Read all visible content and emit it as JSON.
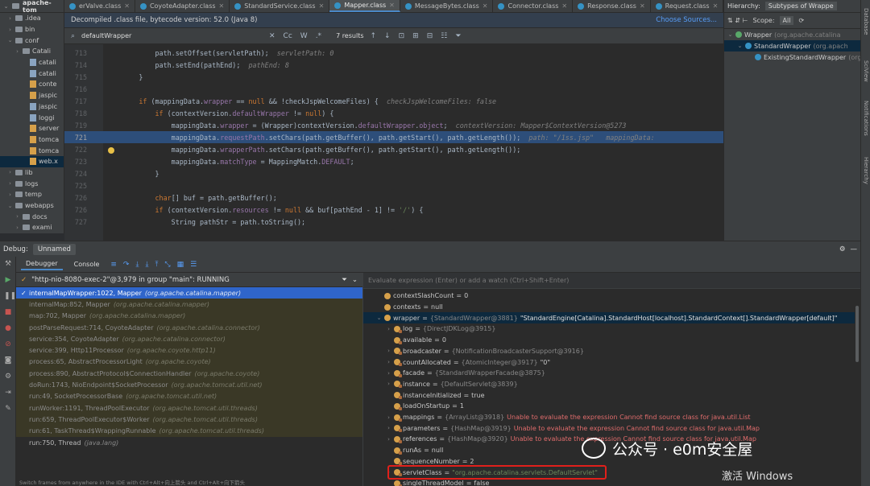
{
  "project": {
    "root": "apache-tom",
    "items": [
      {
        "label": ".idea",
        "kind": "folder",
        "indent": 1,
        "caret": "›"
      },
      {
        "label": "bin",
        "kind": "folder",
        "indent": 1,
        "caret": "›"
      },
      {
        "label": "conf",
        "kind": "folder",
        "indent": 1,
        "caret": "⌄"
      },
      {
        "label": "Catali",
        "kind": "folder",
        "indent": 2,
        "caret": "›"
      },
      {
        "label": "catali",
        "kind": "file",
        "indent": 3,
        "caret": ""
      },
      {
        "label": "catali",
        "kind": "file",
        "indent": 3,
        "caret": ""
      },
      {
        "label": "conte",
        "kind": "xml",
        "indent": 3,
        "caret": ""
      },
      {
        "label": "jaspic",
        "kind": "xml",
        "indent": 3,
        "caret": ""
      },
      {
        "label": "jaspic",
        "kind": "file",
        "indent": 3,
        "caret": ""
      },
      {
        "label": "loggi",
        "kind": "file",
        "indent": 3,
        "caret": ""
      },
      {
        "label": "server",
        "kind": "xml",
        "indent": 3,
        "caret": ""
      },
      {
        "label": "tomca",
        "kind": "xml",
        "indent": 3,
        "caret": ""
      },
      {
        "label": "tomca",
        "kind": "xml",
        "indent": 3,
        "caret": ""
      },
      {
        "label": "web.x",
        "kind": "xml",
        "indent": 3,
        "caret": "",
        "selected": true
      },
      {
        "label": "lib",
        "kind": "folder",
        "indent": 1,
        "caret": "›"
      },
      {
        "label": "logs",
        "kind": "folder",
        "indent": 1,
        "caret": "›"
      },
      {
        "label": "temp",
        "kind": "folder",
        "indent": 1,
        "caret": "›"
      },
      {
        "label": "webapps",
        "kind": "folder",
        "indent": 1,
        "caret": "⌄"
      },
      {
        "label": "docs",
        "kind": "folder",
        "indent": 2,
        "caret": "›"
      },
      {
        "label": "exami",
        "kind": "folder",
        "indent": 2,
        "caret": "›"
      }
    ]
  },
  "tabs": [
    {
      "label": "erValve.class",
      "active": false
    },
    {
      "label": "CoyoteAdapter.class",
      "active": false
    },
    {
      "label": "StandardService.class",
      "active": false
    },
    {
      "label": "Mapper.class",
      "active": true
    },
    {
      "label": "MessageBytes.class",
      "active": false
    },
    {
      "label": "Connector.class",
      "active": false
    },
    {
      "label": "Response.class",
      "active": false
    },
    {
      "label": "Request.class",
      "active": false
    }
  ],
  "banner": {
    "text": "Decompiled .class file, bytecode version: 52.0 (Java 8)",
    "link": "Choose Sources..."
  },
  "search": {
    "query": "defaultWrapper",
    "results": "7 results",
    "case_label": "Cc",
    "word_label": "W"
  },
  "code": [
    {
      "n": "713",
      "t": [
        [
          "",
          "            path.setOffset(servletPath);  "
        ],
        [
          "cm",
          "servletPath: 0"
        ]
      ]
    },
    {
      "n": "714",
      "t": [
        [
          "",
          "            path.setEnd(pathEnd);  "
        ],
        [
          "cm",
          "pathEnd: 8"
        ]
      ]
    },
    {
      "n": "715",
      "t": [
        [
          "",
          "        }"
        ]
      ]
    },
    {
      "n": "716",
      "t": [
        [
          "",
          ""
        ]
      ]
    },
    {
      "n": "717",
      "t": [
        [
          "",
          "        "
        ],
        [
          "kw",
          "if"
        ],
        [
          "",
          " (mappingData."
        ],
        [
          "fld",
          "wrapper"
        ],
        [
          "",
          " == "
        ],
        [
          "kw",
          "null"
        ],
        [
          "",
          " && !checkJspWelcomeFiles) {  "
        ],
        [
          "cm",
          "checkJspWelcomeFiles: false"
        ]
      ]
    },
    {
      "n": "718",
      "t": [
        [
          "",
          "            "
        ],
        [
          "kw",
          "if"
        ],
        [
          "",
          " (contextVersion."
        ],
        [
          "fld",
          "defaultWrapper"
        ],
        [
          "",
          " != "
        ],
        [
          "kw",
          "null"
        ],
        [
          "",
          ") {"
        ]
      ]
    },
    {
      "n": "719",
      "t": [
        [
          "",
          "                mappingData."
        ],
        [
          "fld",
          "wrapper"
        ],
        [
          "",
          " = (Wrapper)contextVersion."
        ],
        [
          "fld",
          "defaultWrapper"
        ],
        [
          "",
          "."
        ],
        [
          "fld",
          "object"
        ],
        [
          "",
          ";  "
        ],
        [
          "cm",
          "contextVersion: Mapper$ContextVersion@5273"
        ]
      ]
    },
    {
      "n": "721",
      "hl": true,
      "t": [
        [
          "",
          "                mappingData."
        ],
        [
          "fld",
          "requestPath"
        ],
        [
          "",
          ".setChars(path.getBuffer(), path.getStart(), path.getLength());  "
        ],
        [
          "cm",
          "path: \"/1ss.jsp\"   mappingData: "
        ]
      ]
    },
    {
      "n": "722",
      "t": [
        [
          "",
          "                mappingData."
        ],
        [
          "fld",
          "wrapperPath"
        ],
        [
          "",
          ".setChars(path.getBuffer(), path.getStart(), path.getLength());"
        ]
      ]
    },
    {
      "n": "723",
      "t": [
        [
          "",
          "                mappingData."
        ],
        [
          "fld",
          "matchType"
        ],
        [
          "",
          " = MappingMatch."
        ],
        [
          "fld",
          "DEFAULT"
        ],
        [
          "",
          ";"
        ]
      ]
    },
    {
      "n": "724",
      "t": [
        [
          "",
          "            }"
        ]
      ]
    },
    {
      "n": "725",
      "t": [
        [
          "",
          ""
        ]
      ]
    },
    {
      "n": "726",
      "t": [
        [
          "",
          "            "
        ],
        [
          "kw",
          "char"
        ],
        [
          "",
          "[] buf = path.getBuffer();"
        ]
      ]
    },
    {
      "n": "726",
      "t": [
        [
          "",
          "            "
        ],
        [
          "kw",
          "if"
        ],
        [
          "",
          " (contextVersion."
        ],
        [
          "fld",
          "resources"
        ],
        [
          "",
          " != "
        ],
        [
          "kw",
          "null"
        ],
        [
          "",
          " && buf[pathEnd - "
        ],
        [
          "",
          "1"
        ],
        [
          "",
          "] != "
        ],
        [
          "str",
          "'/'"
        ],
        [
          "",
          ") {"
        ]
      ]
    },
    {
      "n": "727",
      "t": [
        [
          "",
          "                String pathStr = path.toString();"
        ]
      ]
    }
  ],
  "hierarchy": {
    "title": "Hierarchy:",
    "tab": "Subtypes of Wrappe",
    "scope_label": "Scope:",
    "scope_value": "All",
    "rows": [
      {
        "label": "Wrapper",
        "pkg": "(org.apache.catalina",
        "indent": 0,
        "selected": false
      },
      {
        "label": "StandardWrapper",
        "pkg": "(org.apach",
        "indent": 1,
        "selected": true
      },
      {
        "label": "ExistingStandardWrapper",
        "pkg": "(org",
        "indent": 2,
        "selected": false
      }
    ]
  },
  "sidebar_right": [
    "Database",
    "SciView",
    "Notifications",
    "Hierarchy"
  ],
  "debug": {
    "label": "Debug:",
    "session": "Unnamed",
    "tabs": [
      "Debugger",
      "Console"
    ],
    "thread": "\"http-nio-8080-exec-2\"@3,979 in group \"main\": RUNNING",
    "frames": [
      {
        "method": "internalMapWrapper:1022, Mapper",
        "pkg": "(org.apache.catalina.mapper)",
        "selected": true
      },
      {
        "method": "internalMap:852, Mapper",
        "pkg": "(org.apache.catalina.mapper)"
      },
      {
        "method": "map:702, Mapper",
        "pkg": "(org.apache.catalina.mapper)"
      },
      {
        "method": "postParseRequest:714, CoyoteAdapter",
        "pkg": "(org.apache.catalina.connector)"
      },
      {
        "method": "service:354, CoyoteAdapter",
        "pkg": "(org.apache.catalina.connector)"
      },
      {
        "method": "service:399, Http11Processor",
        "pkg": "(org.apache.coyote.http11)"
      },
      {
        "method": "process:65, AbstractProcessorLight",
        "pkg": "(org.apache.coyote)"
      },
      {
        "method": "process:890, AbstractProtocol$ConnectionHandler",
        "pkg": "(org.apache.coyote)"
      },
      {
        "method": "doRun:1743, NioEndpoint$SocketProcessor",
        "pkg": "(org.apache.tomcat.util.net)"
      },
      {
        "method": "run:49, SocketProcessorBase",
        "pkg": "(org.apache.tomcat.util.net)"
      },
      {
        "method": "runWorker:1191, ThreadPoolExecutor",
        "pkg": "(org.apache.tomcat.util.threads)"
      },
      {
        "method": "run:659, ThreadPoolExecutor$Worker",
        "pkg": "(org.apache.tomcat.util.threads)"
      },
      {
        "method": "run:61, TaskThread$WrappingRunnable",
        "pkg": "(org.apache.tomcat.util.threads)"
      },
      {
        "method": "run:750, Thread",
        "pkg": "(java.lang)",
        "bright": true
      }
    ],
    "hint": "Switch frames from anywhere in the IDE with Ctrl+Alt+向上箭头 and Ctrl+Alt+向下箭头",
    "eval_placeholder": "Evaluate expression (Enter) or add a watch (Ctrl+Shift+Enter)",
    "vars": [
      {
        "i": 0,
        "caret": "",
        "name": "contextSlashCount",
        "eq": " = ",
        "type": "",
        "val": "0",
        "cls": ""
      },
      {
        "i": 0,
        "caret": "",
        "name": "contexts",
        "eq": " = ",
        "type": "",
        "val": "null",
        "cls": ""
      },
      {
        "i": 0,
        "caret": "⌄",
        "name": "wrapper",
        "eq": " = ",
        "type": "{StandardWrapper@3881} ",
        "val": "\"StandardEngine[Catalina].StandardHost[localhost].StandardContext[].StandardWrapper[default]\"",
        "cls": "",
        "selected": true
      },
      {
        "i": 1,
        "caret": "›",
        "name": "log",
        "eq": " = ",
        "type": "{DirectJDKLog@3915}",
        "val": "",
        "cls": ""
      },
      {
        "i": 1,
        "caret": "",
        "name": "available",
        "eq": " = ",
        "type": "",
        "val": "0",
        "cls": ""
      },
      {
        "i": 1,
        "caret": "›",
        "name": "broadcaster",
        "eq": " = ",
        "type": "{NotificationBroadcasterSupport@3916}",
        "val": "",
        "cls": ""
      },
      {
        "i": 1,
        "caret": "›",
        "name": "countAllocated",
        "eq": " = ",
        "type": "{AtomicInteger@3917} ",
        "val": "\"0\"",
        "cls": ""
      },
      {
        "i": 1,
        "caret": "›",
        "name": "facade",
        "eq": " = ",
        "type": "{StandardWrapperFacade@3875}",
        "val": "",
        "cls": ""
      },
      {
        "i": 1,
        "caret": "›",
        "name": "instance",
        "eq": " = ",
        "type": "{DefaultServlet@3839}",
        "val": "",
        "cls": ""
      },
      {
        "i": 1,
        "caret": "",
        "name": "instanceInitialized",
        "eq": " = ",
        "type": "",
        "val": "true",
        "cls": ""
      },
      {
        "i": 1,
        "caret": "",
        "name": "loadOnStartup",
        "eq": " = ",
        "type": "",
        "val": "1",
        "cls": ""
      },
      {
        "i": 1,
        "caret": "›",
        "name": "mappings",
        "eq": " = ",
        "type": "{ArrayList@3918} ",
        "val": "Unable to evaluate the expression Cannot find source class for java.util.List",
        "cls": "err"
      },
      {
        "i": 1,
        "caret": "›",
        "name": "parameters",
        "eq": " = ",
        "type": "{HashMap@3919} ",
        "val": "Unable to evaluate the expression Cannot find source class for java.util.Map",
        "cls": "err"
      },
      {
        "i": 1,
        "caret": "›",
        "name": "references",
        "eq": " = ",
        "type": "{HashMap@3920} ",
        "val": "Unable to evaluate the expression Cannot find source class for java.util.Map",
        "cls": "err"
      },
      {
        "i": 1,
        "caret": "",
        "name": "runAs",
        "eq": " = ",
        "type": "",
        "val": "null",
        "cls": ""
      },
      {
        "i": 1,
        "caret": "",
        "name": "sequenceNumber",
        "eq": " = ",
        "type": "",
        "val": "2",
        "cls": ""
      },
      {
        "i": 1,
        "caret": "›",
        "name": "servletClass",
        "eq": " = ",
        "type": "",
        "val": "\"org.apache.catalina.servlets.DefaultServlet\"",
        "cls": "str",
        "boxed": true
      },
      {
        "i": 1,
        "caret": "",
        "name": "singleThreadModel",
        "eq": " = ",
        "type": "",
        "val": "false",
        "cls": ""
      }
    ]
  },
  "watermark": {
    "text": "公众号 · e0m安全屋",
    "activate": "激活 Windows"
  }
}
